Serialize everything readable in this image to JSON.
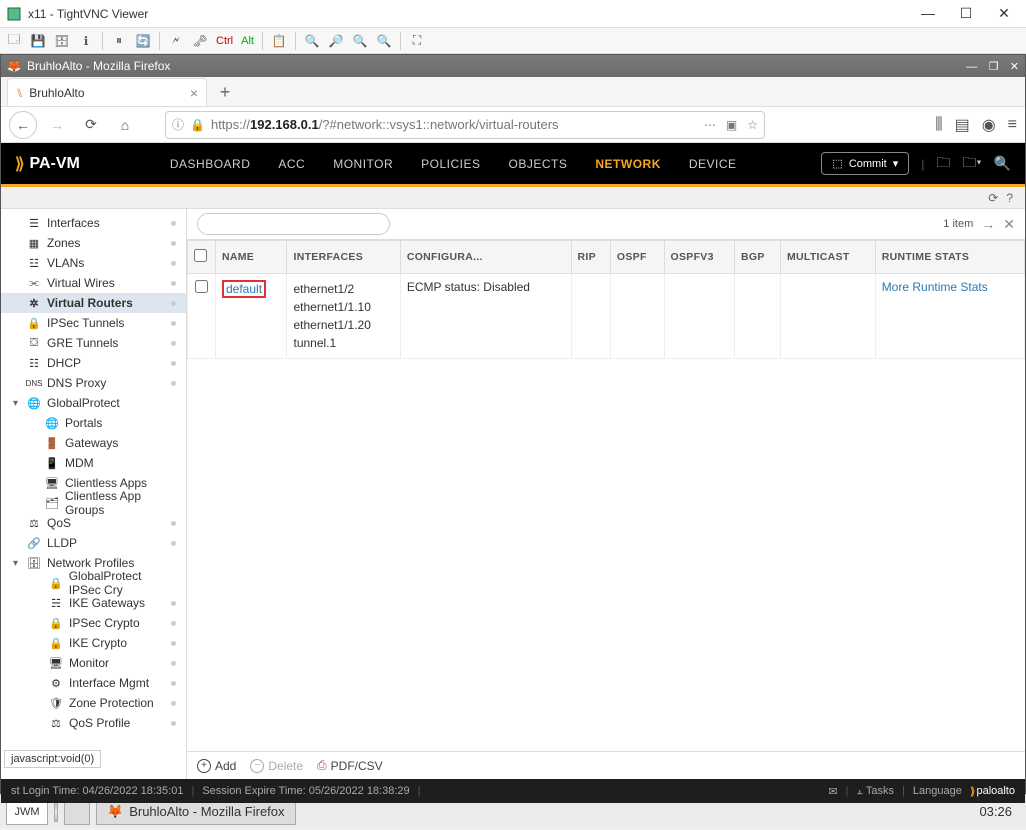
{
  "vnc": {
    "title": "x11 - TightVNC Viewer"
  },
  "firefox": {
    "window_title": "BruhloAlto - Mozilla Firefox",
    "tab_title": "BruhloAlto",
    "url_prefix": "https://",
    "url_host": "192.168.0.1",
    "url_path": "/?#network::vsys1::network/virtual-routers",
    "status_text": "javascript:void(0)"
  },
  "pan": {
    "brand": "PA-VM",
    "nav": {
      "dashboard": "DASHBOARD",
      "acc": "ACC",
      "monitor": "MONITOR",
      "policies": "POLICIES",
      "objects": "OBJECTS",
      "network": "NETWORK",
      "device": "DEVICE"
    },
    "commit": "Commit",
    "item_count": "1 item",
    "columns": {
      "name": "NAME",
      "interfaces": "INTERFACES",
      "config": "CONFIGURA...",
      "rip": "RIP",
      "ospf": "OSPF",
      "ospfv3": "OSPFV3",
      "bgp": "BGP",
      "multicast": "MULTICAST",
      "runtime": "RUNTIME STATS"
    },
    "row": {
      "name": "default",
      "interfaces": [
        "ethernet1/2",
        "ethernet1/1.10",
        "ethernet1/1.20",
        "tunnel.1"
      ],
      "config": "ECMP status: Disabled",
      "runtime_link": "More Runtime Stats"
    },
    "actions": {
      "add": "Add",
      "delete": "Delete",
      "pdf": "PDF/CSV"
    },
    "footer": {
      "login": "st Login Time: 04/26/2022 18:35:01",
      "expire": "Session Expire Time: 05/26/2022 18:38:29",
      "tasks": "Tasks",
      "language": "Language",
      "brand": "paloalto"
    }
  },
  "sidebar": {
    "interfaces": "Interfaces",
    "zones": "Zones",
    "vlans": "VLANs",
    "vwires": "Virtual Wires",
    "vrouters": "Virtual Routers",
    "ipsec": "IPSec Tunnels",
    "gre": "GRE Tunnels",
    "dhcp": "DHCP",
    "dnsproxy": "DNS Proxy",
    "globalprotect": "GlobalProtect",
    "portals": "Portals",
    "gateways": "Gateways",
    "mdm": "MDM",
    "clientless": "Clientless Apps",
    "clientlessgrp": "Clientless App Groups",
    "qos": "QoS",
    "lldp": "LLDP",
    "netprofiles": "Network Profiles",
    "gp_ipsec": "GlobalProtect IPSec Cry",
    "ike_gw": "IKE Gateways",
    "ipsec_crypto": "IPSec Crypto",
    "ike_crypto": "IKE Crypto",
    "np_monitor": "Monitor",
    "if_mgmt": "Interface Mgmt",
    "zone_prot": "Zone Protection",
    "qos_profile": "QoS Profile"
  },
  "taskbar": {
    "start": "JWM",
    "app": "BruhloAlto - Mozilla Firefox",
    "clock": "03:26"
  }
}
